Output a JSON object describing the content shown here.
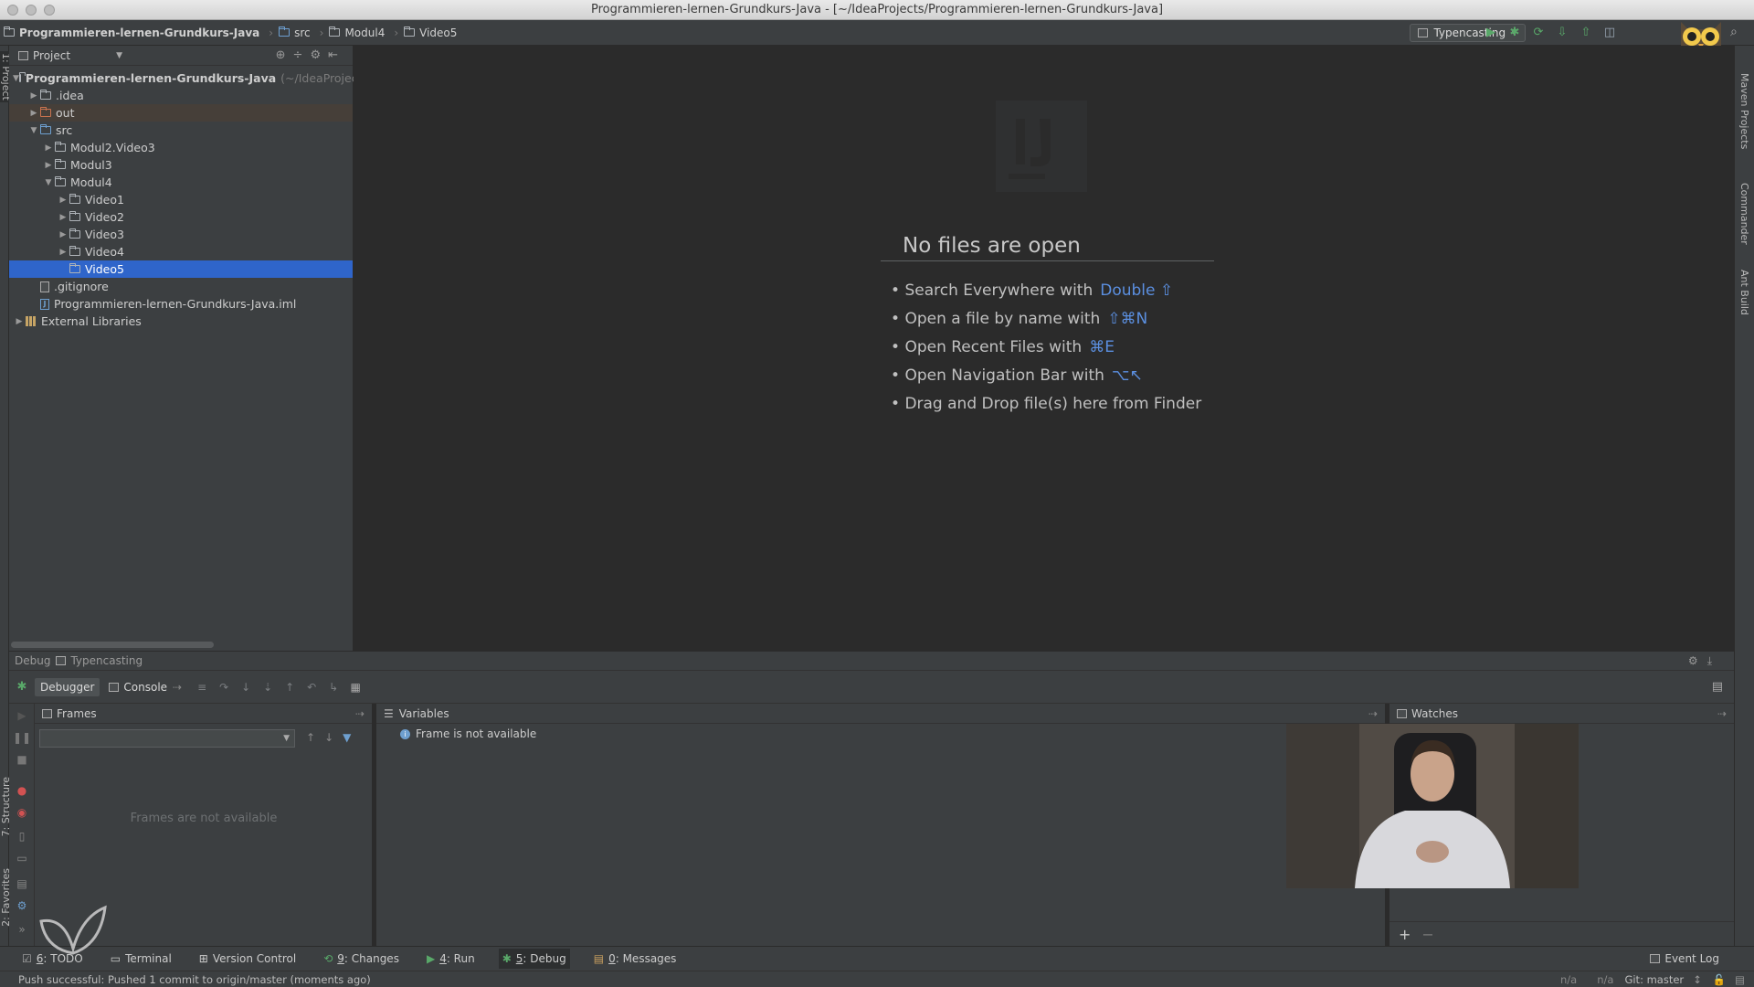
{
  "window": {
    "title": "Programmieren-lernen-Grundkurs-Java - [~/IdeaProjects/Programmieren-lernen-Grundkurs-Java]"
  },
  "navbar": {
    "breadcrumbs": [
      "Programmieren-lernen-Grundkurs-Java",
      "src",
      "Modul4",
      "Video5"
    ],
    "run_config": "Typencasting"
  },
  "sidebar": {
    "left_tab": "1: Project",
    "bottom_tabs": [
      "7: Structure",
      "2: Favorites"
    ],
    "right_tabs": [
      "Maven Projects",
      "Commander",
      "Ant Build"
    ]
  },
  "project": {
    "header": "Project",
    "tree": [
      {
        "label": "Programmieren-lernen-Grundkurs-Java",
        "hint": "(~/IdeaProject",
        "level": 0,
        "arrow": "down",
        "icon": "module"
      },
      {
        "label": ".idea",
        "level": 1,
        "arrow": "right",
        "icon": "folder"
      },
      {
        "label": "out",
        "level": 1,
        "arrow": "right",
        "icon": "folder-red"
      },
      {
        "label": "src",
        "level": 1,
        "arrow": "down",
        "icon": "folder-blue"
      },
      {
        "label": "Modul2.Video3",
        "level": 2,
        "arrow": "right",
        "icon": "package"
      },
      {
        "label": "Modul3",
        "level": 2,
        "arrow": "right",
        "icon": "package"
      },
      {
        "label": "Modul4",
        "level": 2,
        "arrow": "down",
        "icon": "package"
      },
      {
        "label": "Video1",
        "level": 3,
        "arrow": "right",
        "icon": "package"
      },
      {
        "label": "Video2",
        "level": 3,
        "arrow": "right",
        "icon": "package"
      },
      {
        "label": "Video3",
        "level": 3,
        "arrow": "right",
        "icon": "package"
      },
      {
        "label": "Video4",
        "level": 3,
        "arrow": "right",
        "icon": "package"
      },
      {
        "label": "Video5",
        "level": 3,
        "arrow": "none",
        "icon": "package",
        "selected": true
      },
      {
        "label": ".gitignore",
        "level": 1,
        "arrow": "none",
        "icon": "file"
      },
      {
        "label": "Programmieren-lernen-Grundkurs-Java.iml",
        "level": 1,
        "arrow": "none",
        "icon": "iml"
      },
      {
        "label": "External Libraries",
        "level": 0,
        "arrow": "right",
        "icon": "library"
      }
    ]
  },
  "editor": {
    "empty_title": "No files are open",
    "items": [
      {
        "text": "Search Everywhere with",
        "key": "Double ⇧"
      },
      {
        "text": "Open a file by name with",
        "key": "⇧⌘N"
      },
      {
        "text": "Open Recent Files with",
        "key": "⌘E"
      },
      {
        "text": "Open Navigation Bar with",
        "key": "⌥↖"
      },
      {
        "text": "Drag and Drop file(s) here from Finder",
        "key": ""
      }
    ]
  },
  "debug": {
    "header_label": "Debug",
    "config": "Typencasting",
    "tabs": [
      "Debugger",
      "Console"
    ],
    "frames_title": "Frames",
    "frames_empty": "Frames are not available",
    "variables_title": "Variables",
    "variables_message": "Frame is not available",
    "watches_title": "Watches"
  },
  "bottom_bar": {
    "items": [
      {
        "num": "6",
        "label": ": TODO"
      },
      {
        "num": "",
        "label": "Terminal"
      },
      {
        "num": "",
        "label": "Version Control"
      },
      {
        "num": "9",
        "label": ": Changes"
      },
      {
        "num": "4",
        "label": ": Run"
      },
      {
        "num": "5",
        "label": ": Debug",
        "active": true
      },
      {
        "num": "0",
        "label": ": Messages"
      }
    ],
    "event_log": "Event Log"
  },
  "status": {
    "message": "Push successful: Pushed 1 commit to origin/master (moments ago)",
    "pos1": "n/a",
    "pos2": "n/a",
    "git": "Git: master"
  }
}
